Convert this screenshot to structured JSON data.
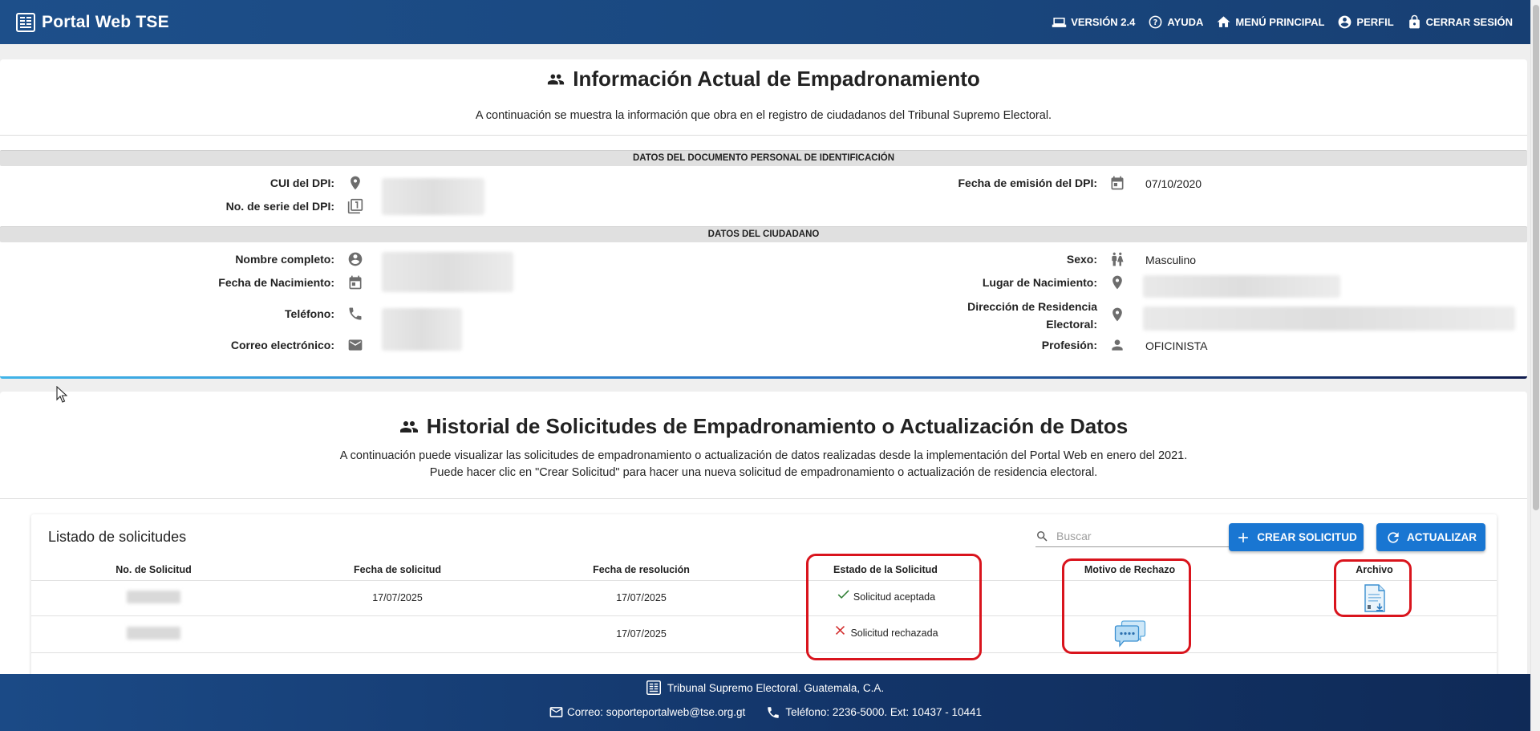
{
  "header": {
    "app_title": "Portal Web TSE",
    "nav": {
      "version": "VERSIÓN 2.4",
      "help": "AYUDA",
      "main_menu": "MENÚ PRINCIPAL",
      "profile": "PERFIL",
      "logout": "CERRAR SESIÓN"
    }
  },
  "current_info": {
    "title": "Información Actual de Empadronamiento",
    "subtitle": "A continuación se muestra la información que obra en el registro de ciudadanos del Tribunal Supremo Electoral.",
    "dpi_section": {
      "heading": "DATOS DEL DOCUMENTO PERSONAL DE IDENTIFICACIÓN",
      "cui_label": "CUI del DPI:",
      "serie_label": "No. de serie del DPI:",
      "emision_label": "Fecha de emisión del DPI:",
      "emision_value": "07/10/2020"
    },
    "citizen_section": {
      "heading": "DATOS DEL CIUDADANO",
      "nombre_label": "Nombre completo:",
      "nacimiento_label": "Fecha de Nacimiento:",
      "telefono_label": "Teléfono:",
      "correo_label": "Correo electrónico:",
      "sexo_label": "Sexo:",
      "sexo_value": "Masculino",
      "lugar_label": "Lugar de Nacimiento:",
      "direccion_label_1": "Dirección de Residencia",
      "direccion_label_2": "Electoral:",
      "profesion_label": "Profesión:",
      "profesion_value": "OFICINISTA"
    }
  },
  "history": {
    "title": "Historial de Solicitudes de Empadronamiento o Actualización de Datos",
    "subtitle_1": "A continuación puede visualizar las solicitudes de empadronamiento o actualización de datos realizadas desde la implementación del Portal Web en enero del 2021.",
    "subtitle_2": "Puede hacer clic en \"Crear Solicitud\" para hacer una nueva solicitud de empadronamiento o actualización de residencia electoral.",
    "list_title": "Listado de solicitudes",
    "search_placeholder": "Buscar",
    "create_button": "CREAR SOLICITUD",
    "refresh_button": "ACTUALIZAR",
    "columns": {
      "numero": "No. de Solicitud",
      "fecha_solicitud": "Fecha de solicitud",
      "fecha_resolucion": "Fecha de resolución",
      "estado": "Estado de la Solicitud",
      "motivo": "Motivo de Rechazo",
      "archivo": "Archivo"
    },
    "rows": [
      {
        "fecha_solicitud": "17/07/2025",
        "fecha_resolucion": "17/07/2025",
        "estado": "Solicitud aceptada"
      },
      {
        "fecha_solicitud": "",
        "fecha_resolucion": "17/07/2025",
        "estado": "Solicitud rechazada"
      }
    ],
    "colors": {
      "accepted": "#2e7d32",
      "rejected": "#d32f2f",
      "highlight": "#d9141d",
      "button": "#1976d2"
    }
  },
  "footer": {
    "org": "Tribunal Supremo Electoral. Guatemala, C.A.",
    "email": "Correo: soporteportalweb@tse.org.gt",
    "phone": "Teléfono: 2236-5000. Ext: 10437 - 10441"
  }
}
